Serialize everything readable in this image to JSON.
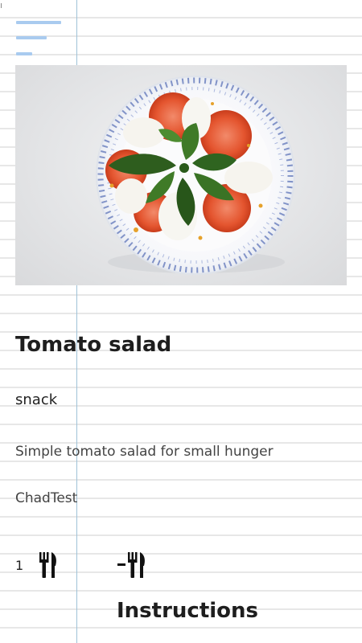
{
  "recipe": {
    "title": "Tomato salad",
    "category": "snack",
    "description": "Simple tomato salad for small hunger",
    "author": "ChadTest",
    "servings": "1"
  },
  "sections": {
    "instructions_title": "Instructions"
  },
  "icons": {
    "menu": "hamburger-menu-icon",
    "servings": "fork-knife-icon",
    "remove_serving": "minus-fork-knife-icon"
  },
  "colors": {
    "menu_icon": "#a9cbef",
    "margin_line": "#9fc2d8",
    "notebook_line": "#e7e7e7",
    "text": "#1e1e1e"
  }
}
